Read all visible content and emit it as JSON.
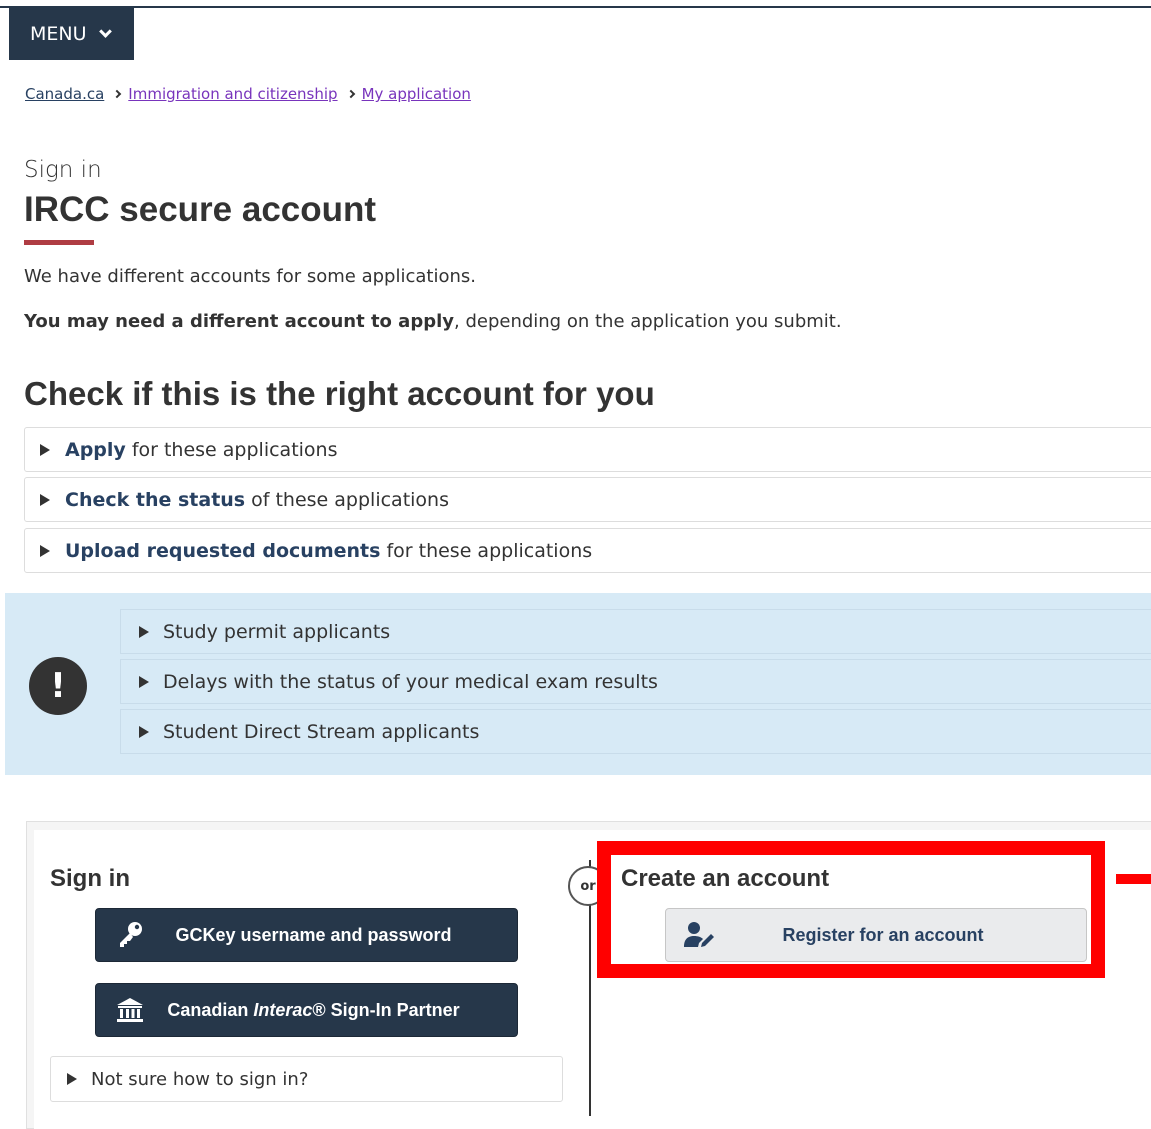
{
  "header": {
    "menu_label": "MENU"
  },
  "breadcrumb": [
    {
      "label": "Canada.ca"
    },
    {
      "label": "Immigration and citizenship"
    },
    {
      "label": "My application"
    }
  ],
  "page": {
    "kicker": "Sign in",
    "title": "IRCC secure account",
    "intro": "We have different accounts for some applications.",
    "note_bold": "You may need a different account to apply",
    "note_rest": ", depending on the application you submit.",
    "section_title": "Check if this is the right account for you"
  },
  "details": [
    {
      "bold": "Apply",
      "rest": "for these applications"
    },
    {
      "bold": "Check the status",
      "rest": "of these applications"
    },
    {
      "bold": "Upload requested documents",
      "rest": "for these applications"
    }
  ],
  "alert": {
    "icon": "exclamation-icon",
    "items": [
      "Study permit applicants",
      "Delays with the status of your medical exam results",
      "Student Direct Stream applicants"
    ]
  },
  "signin_panel": {
    "heading": "Sign in",
    "gckey_label": "GCKey username and password",
    "interac_label_pre": "Canadian ",
    "interac_label_em": "Interac",
    "interac_label_post": "® Sign-In Partner",
    "not_sure": "Not sure how to sign in?",
    "or_label": "or"
  },
  "create_panel": {
    "heading": "Create an account",
    "register_label": "Register for an account"
  },
  "colors": {
    "primary_dark": "#26374a",
    "link": "#284162",
    "accent_red": "#af3c43",
    "alert_bg": "#d7eaf6",
    "highlight": "#ff0000"
  }
}
